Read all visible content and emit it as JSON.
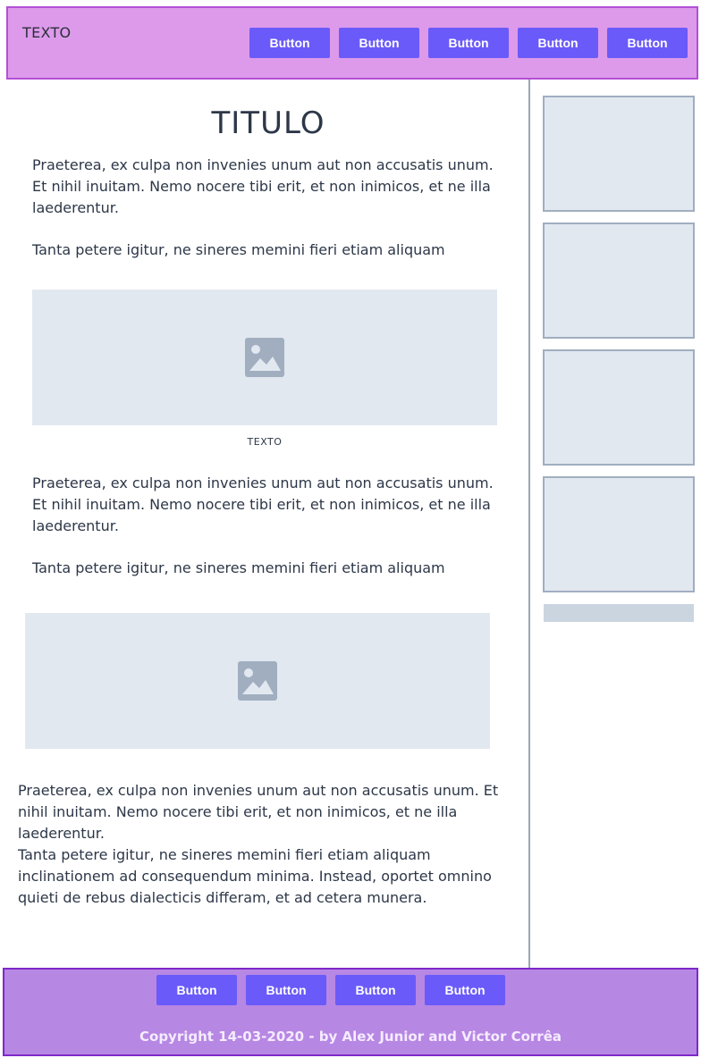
{
  "header": {
    "brand_text": "TEXTO",
    "buttons": [
      "Button",
      "Button",
      "Button",
      "Button",
      "Button"
    ]
  },
  "main": {
    "title": "TITULO",
    "section1": {
      "p1": "Praeterea, ex culpa non invenies unum aut non accusatis unum. Et nihil inuitam. Nemo nocere tibi erit, et non inimicos, et ne illa laederentur.",
      "p2": "Tanta petere igitur, ne sineres memini fieri etiam aliquam"
    },
    "image1_caption": "TEXTO",
    "section2": {
      "p1": "Praeterea, ex culpa non invenies unum aut non accusatis unum. Et nihil inuitam. Nemo nocere tibi erit, et non inimicos, et ne illa laederentur.",
      "p2": "Tanta petere igitur, ne sineres memini fieri etiam aliquam"
    },
    "section3": {
      "p1": "Praeterea, ex culpa non invenies unum aut non accusatis unum. Et nihil inuitam. Nemo nocere tibi erit, et non inimicos, et ne illa laederentur.",
      "p2": "Tanta petere igitur, ne sineres memini fieri etiam aliquam inclinationem ad consequendum minima. Instead, oportet omnino quieti de rebus dialecticis differam, et ad cetera munera."
    },
    "image_icon": "image-placeholder-icon"
  },
  "footer": {
    "buttons": [
      "Button",
      "Button",
      "Button",
      "Button"
    ],
    "copyright": "Copyright 14-03-2020 - by Alex Junior and Victor Corrêa"
  },
  "colors": {
    "header_bg": "#dd9aea",
    "footer_bg": "#b787e4",
    "button_bg": "#6a5af9",
    "placeholder_bg": "#e2e8f0"
  }
}
